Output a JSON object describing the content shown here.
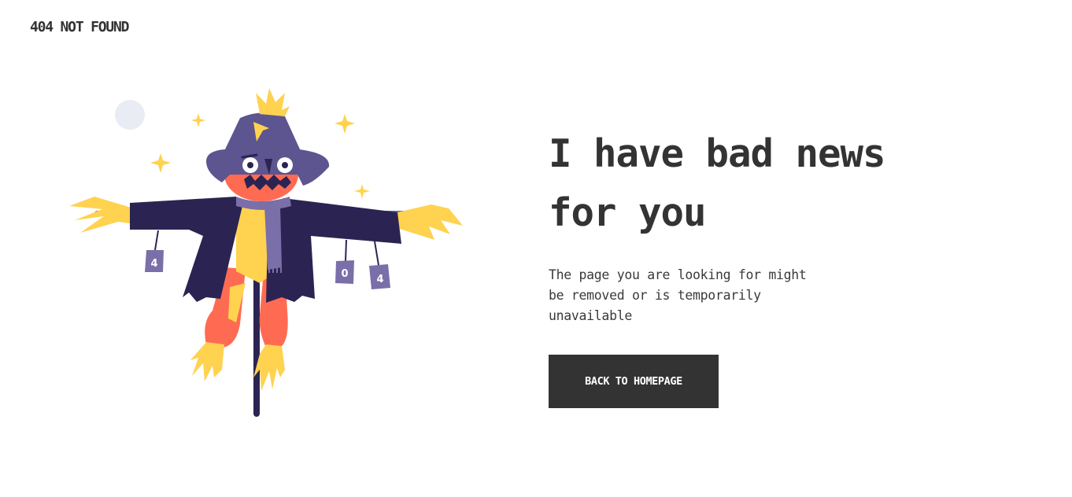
{
  "header": {
    "title": "404 NOT FOUND"
  },
  "illustration": {
    "can_labels": [
      "4",
      "0",
      "4"
    ]
  },
  "main": {
    "heading": "I have bad news for you",
    "description": "The page you are looking for might be removed or is temporarily unavailable",
    "button_label": "BACK TO HOMEPAGE"
  },
  "colors": {
    "text": "#333333",
    "button_bg": "#333333",
    "button_text": "#ffffff",
    "hat": "#5c5590",
    "coat": "#2b2452",
    "face": "#ff6b52",
    "straw": "#ffd24f",
    "scarf": "#7a6fa8",
    "moon": "#e9ecf5"
  }
}
